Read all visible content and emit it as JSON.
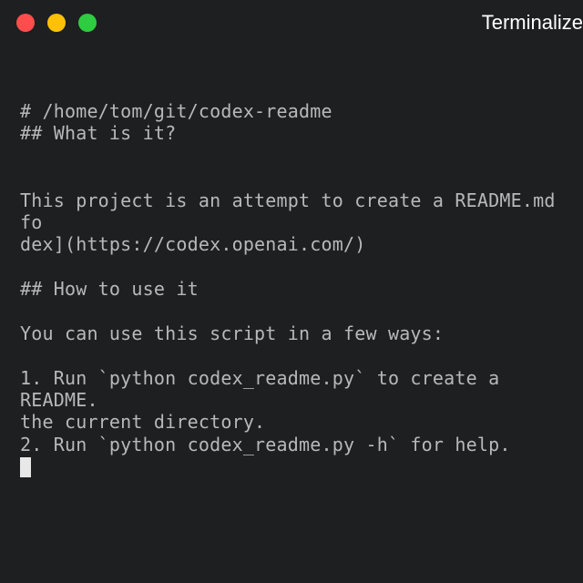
{
  "window": {
    "title": "Terminalize",
    "traffic_lights": {
      "close": "close",
      "minimize": "minimize",
      "zoom": "zoom"
    }
  },
  "terminal": {
    "lines": [
      "# /home/tom/git/codex-readme",
      "## What is it?",
      "",
      "",
      "This project is an attempt to create a README.md fo",
      "dex](https://codex.openai.com/)",
      "",
      "## How to use it",
      "",
      "You can use this script in a few ways:",
      "",
      "1. Run `python codex_readme.py` to create a README.",
      "the current directory.",
      "2. Run `python codex_readme.py -h` for help."
    ]
  }
}
